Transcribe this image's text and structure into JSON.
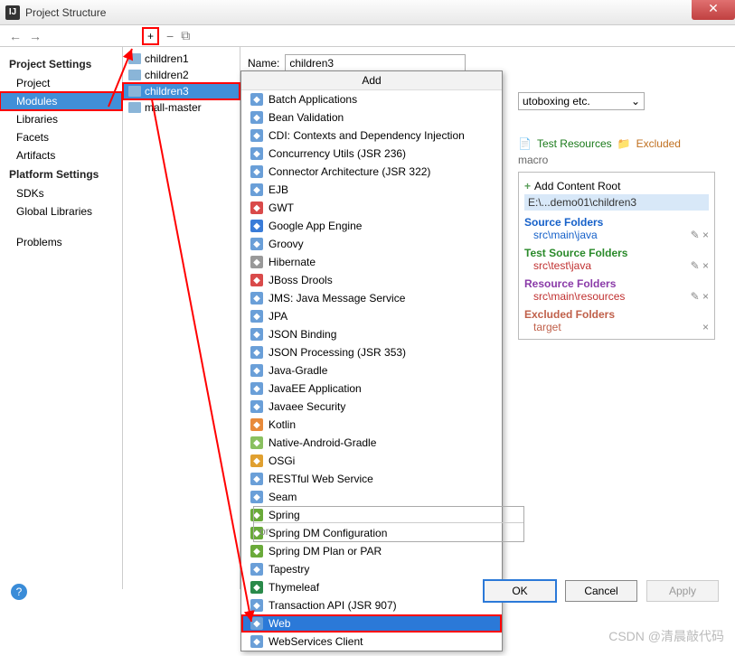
{
  "window": {
    "title": "Project Structure",
    "close": "✕"
  },
  "toolbar": {
    "back": "←",
    "forward": "→",
    "plus": "+",
    "minus": "−",
    "copy": "⧉"
  },
  "sidebar": {
    "heading1": "Project Settings",
    "items1": [
      "Project",
      "Modules",
      "Libraries",
      "Facets",
      "Artifacts"
    ],
    "heading2": "Platform Settings",
    "items2": [
      "SDKs",
      "Global Libraries"
    ],
    "problems": "Problems"
  },
  "modules": [
    "children1",
    "children2",
    "children3",
    "mall-master"
  ],
  "name": {
    "label": "Name:",
    "value": "children3"
  },
  "popup": {
    "title": "Add",
    "items": [
      "Batch Applications",
      "Bean Validation",
      "CDI: Contexts and Dependency Injection",
      "Concurrency Utils (JSR 236)",
      "Connector Architecture (JSR 322)",
      "EJB",
      "GWT",
      "Google App Engine",
      "Groovy",
      "Hibernate",
      "JBoss Drools",
      "JMS: Java Message Service",
      "JPA",
      "JSON Binding",
      "JSON Processing (JSR 353)",
      "Java-Gradle",
      "JavaEE Application",
      "Javaee Security",
      "Kotlin",
      "Native-Android-Gradle",
      "OSGi",
      "RESTful Web Service",
      "Seam",
      "Spring",
      "Spring DM Configuration",
      "Spring DM Plan or PAR",
      "Tapestry",
      "Thymeleaf",
      "Transaction API (JSR 907)",
      "Web",
      "WebServices Client"
    ],
    "selected": "Web"
  },
  "right": {
    "combo": "utoboxing etc.",
    "tag_test": "Test Resources",
    "tag_excl": "Excluded",
    "macro_label": "macro",
    "add_root": "Add Content Root",
    "root_path": "E:\\...demo01\\children3",
    "source_hdr": "Source Folders",
    "source_items": [
      "src\\main\\java"
    ],
    "test_hdr": "Test Source Folders",
    "test_items": [
      "src\\test\\java"
    ],
    "res_hdr": "Resource Folders",
    "res_items": [
      "src\\main\\resources"
    ],
    "excl_hdr": "Excluded Folders",
    "excl_items": [
      "target"
    ]
  },
  "search": {
    "or": "or"
  },
  "buttons": {
    "ok": "OK",
    "cancel": "Cancel",
    "apply": "Apply"
  },
  "help": "?",
  "watermark": "CSDN @清晨敲代码"
}
